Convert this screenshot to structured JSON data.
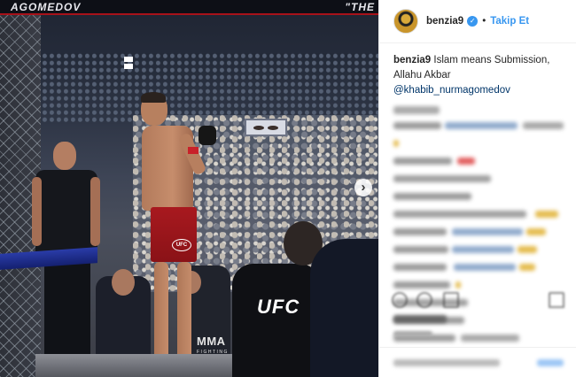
{
  "photo": {
    "banner_left": "AGOMEDOV",
    "banner_right": "\"THE",
    "shorts_logo": "UFC",
    "shirt_text": "UFC",
    "watermark_main": "MMA",
    "watermark_sub": "FIGHTING",
    "next_arrow": "›"
  },
  "header": {
    "username": "benzia9",
    "verified_glyph": "✓",
    "separator": "•",
    "follow_label": "Takip Et"
  },
  "caption": {
    "username": "benzia9",
    "text": "Islam means Submission, Allahu Akbar",
    "mention": "@khabib_nurmagomedov"
  },
  "colors": {
    "accent": "#3897f0",
    "mention": "#003569",
    "text": "#262626",
    "ufc_red": "#a8191f"
  }
}
